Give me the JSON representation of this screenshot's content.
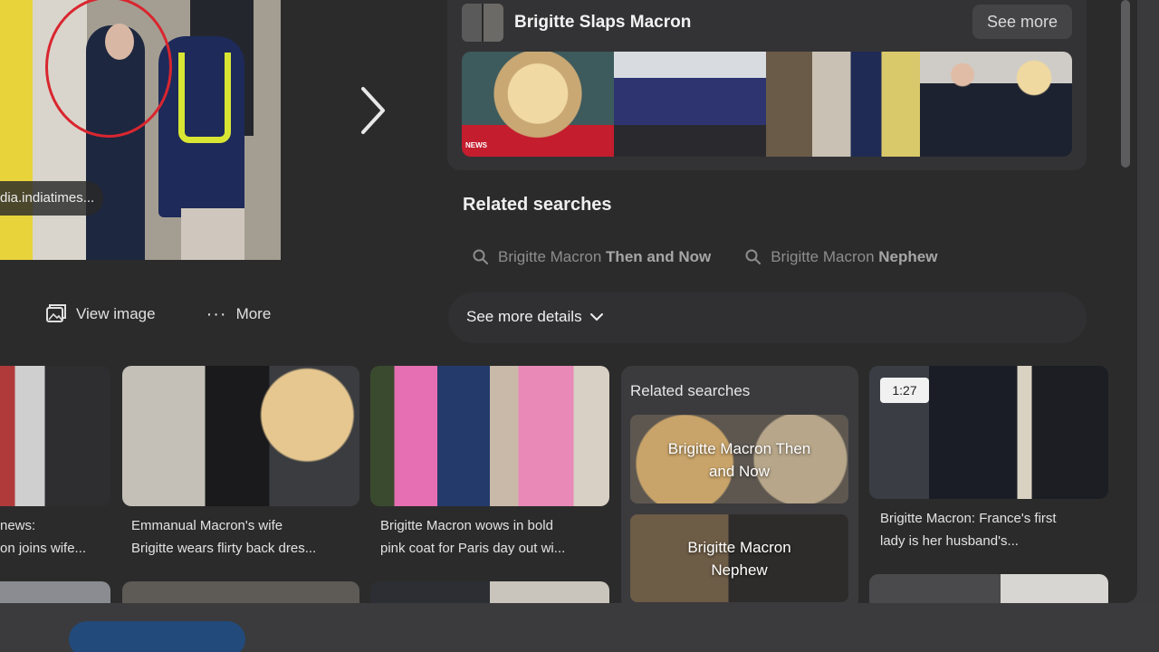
{
  "main_image": {
    "source": "dia.indiatimes..."
  },
  "actions": {
    "view_image": "View image",
    "more": "More"
  },
  "card": {
    "title": "Brigitte Slaps Macron",
    "see_more": "See more",
    "news_tag": "NEWS"
  },
  "related": {
    "title": "Related searches",
    "chip1_prefix": "Brigitte Macron ",
    "chip1_bold": "Then and Now",
    "chip2_prefix": "Brigitte Macron ",
    "chip2_bold": "Nephew",
    "see_more_details": "See more details"
  },
  "grid": {
    "tile1_line1": "news:",
    "tile1_line2": "on joins wife...",
    "tile2_line1": "Emmanual Macron's wife",
    "tile2_line2": "Brigitte wears flirty back dres...",
    "tile3_line1": "Brigitte Macron wows in bold",
    "tile3_line2": "pink coat for Paris day out wi...",
    "related_card_title": "Related searches",
    "related_item1_line1": "Brigitte Macron Then",
    "related_item1_line2": "and Now",
    "related_item2_line1": "Brigitte Macron",
    "related_item2_line2": "Nephew",
    "video_duration": "1:27",
    "tile5_line1": "Brigitte Macron: France's first",
    "tile5_line2": "lady is her husband's..."
  },
  "icons": {
    "next": "chevron-right-icon",
    "view_image": "image-icon",
    "more": "more-dots-icon",
    "search": "search-icon",
    "expand": "chevron-down-icon"
  }
}
